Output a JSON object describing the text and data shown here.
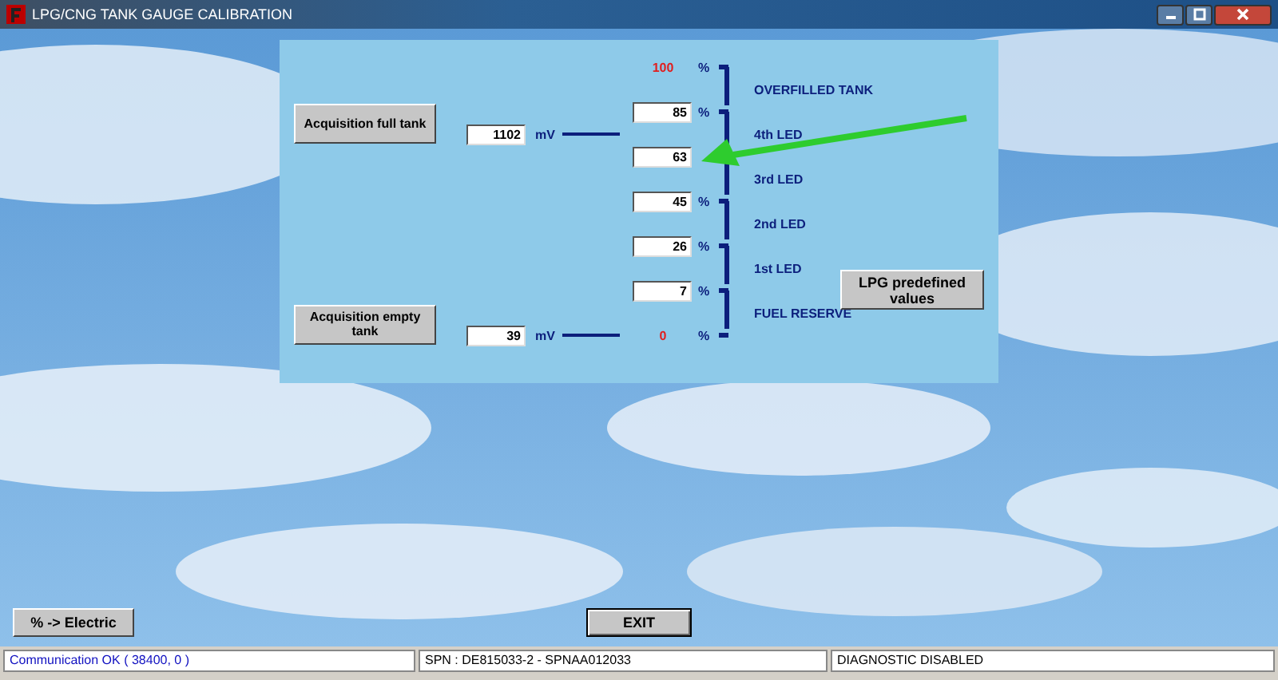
{
  "window": {
    "title": "LPG/CNG TANK GAUGE CALIBRATION"
  },
  "calibration": {
    "full": {
      "button": "Acquisition full tank",
      "mv": "1102",
      "unit": "mV"
    },
    "empty": {
      "button": "Acquisition empty tank",
      "mv": "39",
      "unit": "mV"
    },
    "levels": [
      {
        "kind": "fixed",
        "value": "100",
        "unit": "%"
      },
      {
        "kind": "field",
        "value": "85",
        "unit": "%"
      },
      {
        "kind": "field",
        "value": "63"
      },
      {
        "kind": "field",
        "value": "45",
        "unit": "%"
      },
      {
        "kind": "field",
        "value": "26",
        "unit": "%"
      },
      {
        "kind": "field",
        "value": "7",
        "unit": "%"
      },
      {
        "kind": "fixed",
        "value": "0",
        "unit": "%"
      }
    ],
    "ranges": [
      "OVERFILLED TANK",
      "4th LED",
      "3rd LED",
      "2nd LED",
      "1st LED",
      "FUEL RESERVE"
    ],
    "predefined_button": "LPG predefined values"
  },
  "buttons": [
    "% -> Electric",
    "EXIT"
  ],
  "status_bar": [
    {
      "text": "Communication OK ( 38400,  0 )",
      "kind": "info"
    },
    {
      "text": "SPN : DE815033-2 - SPNAA012033",
      "kind": "plain"
    },
    {
      "text": "DIAGNOSTIC DISABLED",
      "kind": "plain"
    }
  ]
}
